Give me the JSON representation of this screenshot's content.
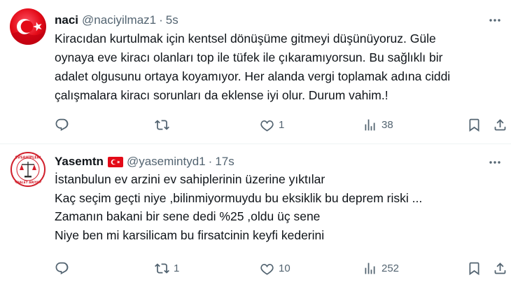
{
  "tweets": [
    {
      "name": "naci",
      "handle": "@naciyilmaz1",
      "dot": "·",
      "time": "5s",
      "has_flag": false,
      "lines": [
        "Kiracıdan kurtulmak için kentsel dönüşüme gitmeyi düşünüyoruz. Güle",
        "oynaya eve kiracı olanları top ile tüfek ile çıkaramıyorsun. Bu sağlıklı bir",
        "adalet olgusunu ortaya koyamıyor. Her alanda vergi toplamak adına ciddi",
        "çalışmalara kiracı sorunları da eklense iyi olur. Durum vahim.!"
      ],
      "reply_count": "",
      "retweet_count": "",
      "like_count": "1",
      "view_count": "38"
    },
    {
      "name": "Yasemtn",
      "handle": "@yasemintyd1",
      "dot": "·",
      "time": "17s",
      "has_flag": true,
      "lines": [
        "İstanbulun ev arzini ev sahiplerinin üzerine yıktılar",
        "Kaç seçim geçti niye ,bilinmiyormuydu bu eksiklik bu deprem  riski ...",
        "Zamanın bakani bir sene dedi %25 ,oldu üç sene",
        "Niye ben  mi karsilicam bu firsatcinin keyfi kederini"
      ],
      "reply_count": "",
      "retweet_count": "1",
      "like_count": "10",
      "view_count": "252"
    }
  ],
  "avatar2_logo_text": [
    "EVSAHİPLERİ",
    "ADALET ARIYOR"
  ],
  "colors": {
    "text": "#0f1419",
    "secondary": "#536471",
    "divider": "#eff3f4",
    "flag_red": "#e30a17"
  },
  "icons": [
    "more-icon",
    "reply-icon",
    "retweet-icon",
    "like-icon",
    "views-icon",
    "bookmark-icon",
    "share-icon"
  ]
}
